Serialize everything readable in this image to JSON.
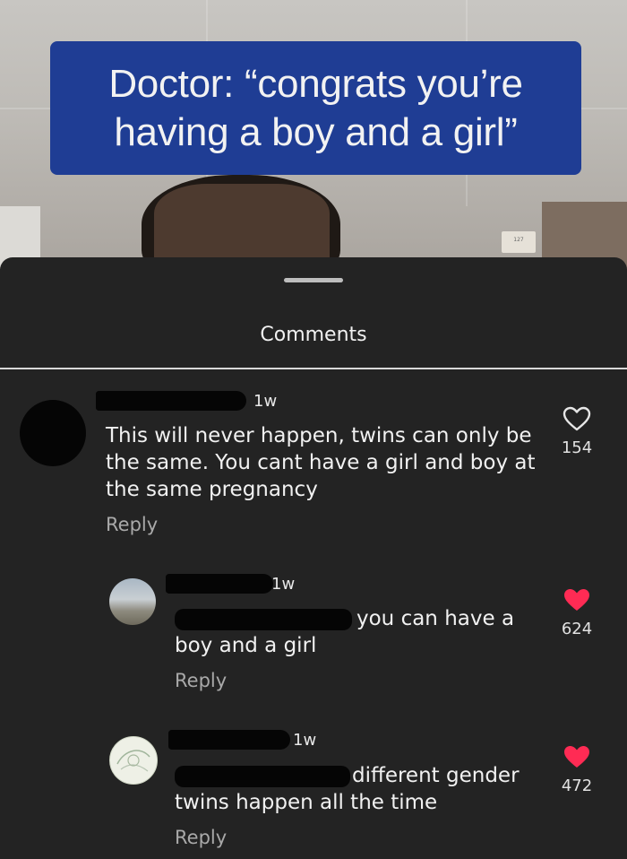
{
  "video": {
    "caption": "Doctor: “congrats you’re\nhaving a boy and a girl”",
    "wall_sign": "127"
  },
  "sheet": {
    "title": "Comments"
  },
  "colors": {
    "heart_active": "#ff2b54",
    "caption_bg": "#1f3d94",
    "sheet_bg": "#232323"
  },
  "comments": [
    {
      "time": "1w",
      "text": "This will never happen, twins can only be\nthe same. You cant have a girl and boy at\nthe same pregnancy",
      "reply_label": "Reply",
      "likes": "154",
      "liked": false
    },
    {
      "time": "1w",
      "text_line1": "you can have a",
      "text_line2": "boy and a girl",
      "reply_label": "Reply",
      "likes": "624",
      "liked": true
    },
    {
      "time": "1w",
      "text_line1": "different gender",
      "text_line2": "twins happen all the time",
      "reply_label": "Reply",
      "likes": "472",
      "liked": true
    }
  ]
}
